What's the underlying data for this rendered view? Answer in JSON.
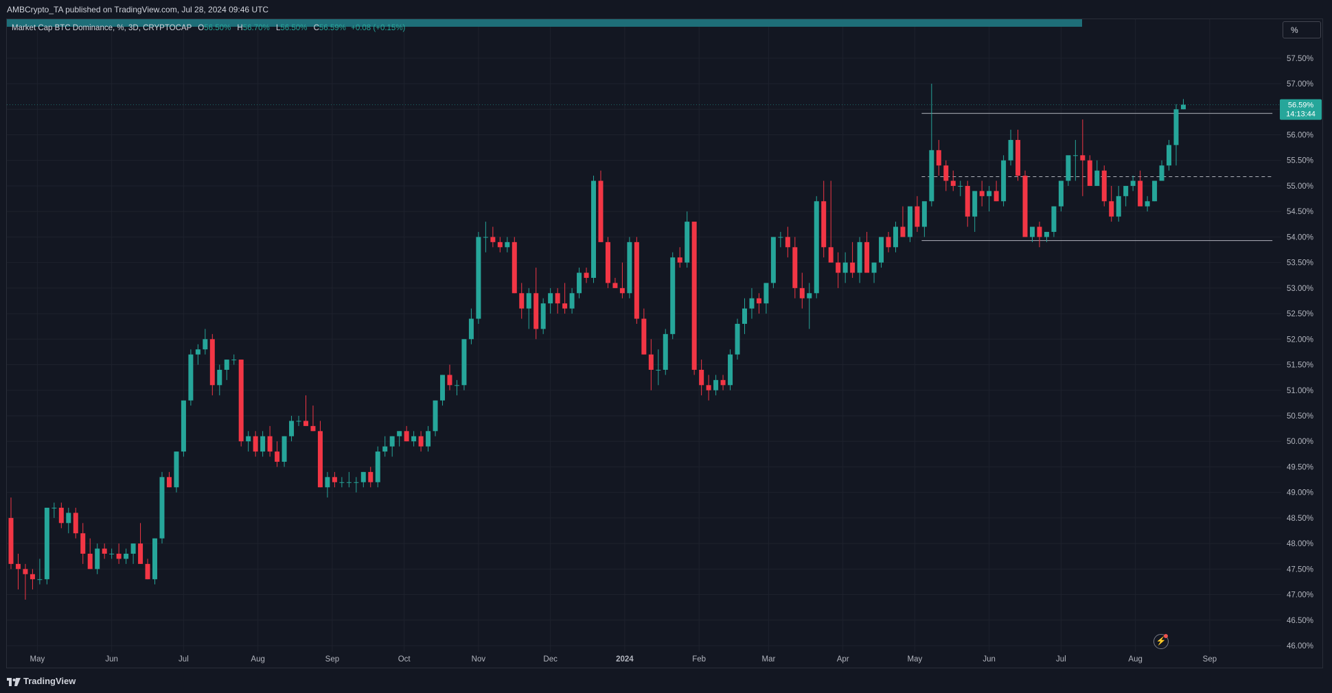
{
  "header": {
    "published": "AMBCrypto_TA published on TradingView.com, Jul 28, 2024 09:46 UTC"
  },
  "legend": {
    "title": "Market Cap BTC Dominance, %, 3D, CRYPTOCAP",
    "o_key": "O",
    "o_val": "56.50%",
    "h_key": "H",
    "h_val": "56.70%",
    "l_key": "L",
    "l_val": "56.50%",
    "c_key": "C",
    "c_val": "56.59%",
    "change": "+0.08 (+0.15%)"
  },
  "toolbar": {
    "unit_button": "%"
  },
  "price_label": {
    "value": "56.59%",
    "countdown": "14:13:44"
  },
  "footer": {
    "brand": "TradingView"
  },
  "colors": {
    "up": "#26a69a",
    "down": "#f23645",
    "background": "#131722",
    "grid": "#1e222d",
    "text": "#b2b5be"
  },
  "chart_data": {
    "type": "candlestick",
    "timeframe": "3D",
    "y_axis": {
      "ylim": [
        46.0,
        57.75
      ],
      "tick_labels": [
        "46.00%",
        "46.50%",
        "47.00%",
        "47.50%",
        "48.00%",
        "48.50%",
        "49.00%",
        "49.50%",
        "50.00%",
        "50.50%",
        "51.00%",
        "51.50%",
        "52.00%",
        "52.50%",
        "53.00%",
        "53.50%",
        "54.00%",
        "54.50%",
        "55.00%",
        "55.50%",
        "56.00%",
        "56.50%",
        "57.00%",
        "57.50%"
      ]
    },
    "x_axis": {
      "labels": [
        "May",
        "Jun",
        "Jul",
        "Aug",
        "Sep",
        "Oct",
        "Nov",
        "Dec",
        "2024",
        "Feb",
        "Mar",
        "Apr",
        "May",
        "Jun",
        "Jul",
        "Aug",
        "Sep"
      ],
      "start_date": "2023-04-20",
      "label_dates": [
        "2023-05-01",
        "2023-06-01",
        "2023-07-01",
        "2023-08-01",
        "2023-09-01",
        "2023-10-01",
        "2023-11-01",
        "2023-12-01",
        "2024-01-01",
        "2024-02-01",
        "2024-03-01",
        "2024-04-01",
        "2024-05-01",
        "2024-06-01",
        "2024-07-01",
        "2024-08-01",
        "2024-09-01"
      ]
    },
    "candles": [
      [
        48.5,
        48.9,
        47.5,
        47.6
      ],
      [
        47.6,
        47.8,
        47.1,
        47.5
      ],
      [
        47.5,
        47.6,
        46.9,
        47.4
      ],
      [
        47.4,
        47.5,
        47.1,
        47.3
      ],
      [
        47.3,
        47.7,
        47.2,
        47.3
      ],
      [
        47.3,
        48.7,
        47.2,
        48.7
      ],
      [
        48.7,
        48.8,
        48.5,
        48.7
      ],
      [
        48.7,
        48.8,
        48.3,
        48.4
      ],
      [
        48.4,
        48.7,
        48.2,
        48.6
      ],
      [
        48.6,
        48.7,
        48.1,
        48.2
      ],
      [
        48.2,
        48.4,
        47.6,
        47.8
      ],
      [
        47.8,
        48.1,
        47.5,
        47.5
      ],
      [
        47.5,
        48.0,
        47.4,
        47.9
      ],
      [
        47.9,
        48.0,
        47.7,
        47.8
      ],
      [
        47.8,
        47.9,
        47.7,
        47.8
      ],
      [
        47.8,
        48.0,
        47.6,
        47.7
      ],
      [
        47.7,
        47.9,
        47.6,
        47.8
      ],
      [
        47.8,
        48.0,
        47.6,
        48.0
      ],
      [
        48.0,
        48.4,
        47.6,
        47.6
      ],
      [
        47.6,
        47.7,
        47.3,
        47.3
      ],
      [
        47.3,
        48.1,
        47.2,
        48.1
      ],
      [
        48.1,
        49.4,
        48.0,
        49.3
      ],
      [
        49.3,
        49.4,
        49.1,
        49.1
      ],
      [
        49.1,
        49.8,
        49.0,
        49.8
      ],
      [
        49.8,
        50.8,
        49.7,
        50.8
      ],
      [
        50.8,
        51.8,
        50.7,
        51.7
      ],
      [
        51.7,
        51.9,
        51.5,
        51.8
      ],
      [
        51.8,
        52.2,
        51.7,
        52.0
      ],
      [
        52.0,
        52.1,
        50.9,
        51.1
      ],
      [
        51.1,
        51.5,
        50.9,
        51.4
      ],
      [
        51.4,
        51.6,
        51.2,
        51.6
      ],
      [
        51.6,
        51.7,
        51.5,
        51.6
      ],
      [
        51.6,
        51.6,
        49.9,
        50.0
      ],
      [
        50.0,
        50.2,
        49.8,
        50.1
      ],
      [
        50.1,
        50.2,
        49.7,
        49.8
      ],
      [
        49.8,
        50.2,
        49.7,
        50.1
      ],
      [
        50.1,
        50.3,
        49.7,
        49.8
      ],
      [
        49.8,
        50.0,
        49.5,
        49.6
      ],
      [
        49.6,
        50.1,
        49.5,
        50.1
      ],
      [
        50.1,
        50.5,
        50.0,
        50.4
      ],
      [
        50.4,
        50.5,
        50.3,
        50.4
      ],
      [
        50.4,
        50.9,
        50.3,
        50.3
      ],
      [
        50.3,
        50.7,
        50.2,
        50.2
      ],
      [
        50.2,
        50.4,
        49.1,
        49.1
      ],
      [
        49.1,
        49.4,
        48.9,
        49.3
      ],
      [
        49.3,
        49.4,
        49.1,
        49.2
      ],
      [
        49.2,
        49.3,
        49.1,
        49.2
      ],
      [
        49.2,
        49.4,
        49.1,
        49.2
      ],
      [
        49.2,
        49.3,
        49.0,
        49.2
      ],
      [
        49.2,
        49.4,
        49.1,
        49.4
      ],
      [
        49.4,
        49.5,
        49.1,
        49.2
      ],
      [
        49.2,
        49.9,
        49.1,
        49.8
      ],
      [
        49.8,
        50.1,
        49.7,
        49.9
      ],
      [
        49.9,
        50.1,
        49.7,
        50.1
      ],
      [
        50.1,
        50.2,
        49.9,
        50.2
      ],
      [
        50.2,
        50.3,
        50.0,
        50.0
      ],
      [
        50.0,
        50.2,
        49.9,
        50.1
      ],
      [
        50.1,
        50.2,
        49.8,
        49.9
      ],
      [
        49.9,
        50.3,
        49.8,
        50.2
      ],
      [
        50.2,
        50.8,
        50.1,
        50.8
      ],
      [
        50.8,
        51.3,
        50.7,
        51.3
      ],
      [
        51.3,
        51.5,
        51.0,
        51.1
      ],
      [
        51.1,
        51.2,
        50.9,
        51.1
      ],
      [
        51.1,
        52.0,
        51.0,
        52.0
      ],
      [
        52.0,
        52.6,
        51.9,
        52.4
      ],
      [
        52.4,
        54.1,
        52.3,
        54.0
      ],
      [
        54.0,
        54.3,
        53.7,
        54.0
      ],
      [
        54.0,
        54.2,
        53.8,
        53.9
      ],
      [
        53.9,
        54.0,
        53.7,
        53.8
      ],
      [
        53.8,
        54.0,
        53.7,
        53.9
      ],
      [
        53.9,
        54.0,
        52.9,
        52.9
      ],
      [
        52.9,
        53.1,
        52.4,
        52.6
      ],
      [
        52.6,
        53.0,
        52.2,
        52.9
      ],
      [
        52.9,
        53.4,
        52.0,
        52.2
      ],
      [
        52.2,
        52.8,
        52.1,
        52.7
      ],
      [
        52.7,
        53.0,
        52.5,
        52.9
      ],
      [
        52.9,
        53.0,
        52.5,
        52.7
      ],
      [
        52.7,
        53.1,
        52.5,
        52.6
      ],
      [
        52.6,
        53.0,
        52.5,
        52.9
      ],
      [
        52.9,
        53.4,
        52.8,
        53.3
      ],
      [
        53.3,
        53.4,
        53.1,
        53.2
      ],
      [
        53.2,
        55.2,
        53.1,
        55.1
      ],
      [
        55.1,
        55.3,
        53.9,
        53.9
      ],
      [
        53.9,
        54.0,
        53.0,
        53.1
      ],
      [
        53.1,
        53.2,
        53.0,
        53.0
      ],
      [
        53.0,
        53.5,
        52.8,
        52.9
      ],
      [
        52.9,
        54.0,
        52.8,
        53.9
      ],
      [
        53.9,
        54.0,
        52.3,
        52.4
      ],
      [
        52.4,
        52.6,
        51.7,
        51.7
      ],
      [
        51.7,
        52.0,
        51.0,
        51.4
      ],
      [
        51.4,
        51.8,
        51.1,
        51.4
      ],
      [
        51.4,
        52.2,
        51.3,
        52.1
      ],
      [
        52.1,
        53.7,
        52.0,
        53.6
      ],
      [
        53.6,
        53.8,
        53.4,
        53.5
      ],
      [
        53.5,
        54.5,
        53.4,
        54.3
      ],
      [
        54.3,
        54.3,
        51.3,
        51.4
      ],
      [
        51.4,
        51.6,
        50.9,
        51.1
      ],
      [
        51.1,
        51.3,
        50.8,
        51.0
      ],
      [
        51.0,
        51.3,
        50.9,
        51.2
      ],
      [
        51.2,
        51.3,
        51.0,
        51.1
      ],
      [
        51.1,
        51.8,
        51.0,
        51.7
      ],
      [
        51.7,
        52.4,
        51.6,
        52.3
      ],
      [
        52.3,
        52.8,
        52.1,
        52.6
      ],
      [
        52.6,
        53.0,
        52.4,
        52.8
      ],
      [
        52.8,
        52.9,
        52.5,
        52.7
      ],
      [
        52.7,
        53.1,
        52.5,
        53.1
      ],
      [
        53.1,
        54.0,
        53.0,
        54.0
      ],
      [
        54.0,
        54.1,
        53.8,
        54.0
      ],
      [
        54.0,
        54.2,
        53.6,
        53.8
      ],
      [
        53.8,
        54.0,
        52.8,
        53.0
      ],
      [
        53.0,
        53.3,
        52.6,
        52.8
      ],
      [
        52.8,
        53.1,
        52.2,
        52.9
      ],
      [
        52.9,
        54.8,
        52.8,
        54.7
      ],
      [
        54.7,
        55.1,
        53.6,
        53.8
      ],
      [
        53.8,
        55.1,
        53.5,
        53.5
      ],
      [
        53.5,
        53.7,
        53.0,
        53.3
      ],
      [
        53.3,
        53.7,
        53.1,
        53.5
      ],
      [
        53.5,
        53.9,
        53.2,
        53.3
      ],
      [
        53.3,
        54.0,
        53.1,
        53.9
      ],
      [
        53.9,
        54.1,
        53.3,
        53.3
      ],
      [
        53.3,
        53.5,
        53.1,
        53.5
      ],
      [
        53.5,
        54.0,
        53.4,
        54.0
      ],
      [
        54.0,
        54.1,
        53.7,
        53.8
      ],
      [
        53.8,
        54.3,
        53.7,
        54.2
      ],
      [
        54.2,
        54.6,
        54.0,
        54.0
      ],
      [
        54.0,
        54.2,
        53.9,
        54.6
      ],
      [
        54.6,
        54.8,
        54.1,
        54.2
      ],
      [
        54.2,
        54.5,
        54.0,
        54.7
      ],
      [
        54.7,
        57.0,
        54.6,
        55.7
      ],
      [
        55.7,
        55.9,
        55.2,
        55.4
      ],
      [
        55.4,
        55.5,
        54.9,
        55.1
      ],
      [
        55.1,
        55.3,
        54.9,
        55.0
      ],
      [
        55.0,
        55.1,
        54.8,
        55.0
      ],
      [
        55.0,
        55.1,
        54.2,
        54.4
      ],
      [
        54.4,
        54.9,
        54.1,
        54.9
      ],
      [
        54.9,
        55.1,
        54.6,
        54.8
      ],
      [
        54.8,
        55.0,
        54.5,
        54.9
      ],
      [
        54.9,
        55.1,
        54.7,
        54.7
      ],
      [
        54.7,
        55.6,
        54.6,
        55.5
      ],
      [
        55.5,
        56.1,
        55.4,
        55.9
      ],
      [
        55.9,
        56.1,
        55.1,
        55.2
      ],
      [
        55.2,
        55.3,
        54.0,
        54.0
      ],
      [
        54.0,
        54.2,
        53.9,
        54.2
      ],
      [
        54.2,
        54.3,
        53.8,
        54.0
      ],
      [
        54.0,
        54.1,
        53.9,
        54.1
      ],
      [
        54.1,
        54.6,
        54.0,
        54.6
      ],
      [
        54.6,
        55.1,
        54.5,
        55.1
      ],
      [
        55.1,
        55.5,
        55.0,
        55.6
      ],
      [
        55.6,
        55.9,
        55.1,
        55.6
      ],
      [
        55.6,
        56.3,
        54.8,
        55.5
      ],
      [
        55.5,
        55.6,
        55.0,
        55.0
      ],
      [
        55.0,
        55.5,
        55.0,
        55.3
      ],
      [
        55.3,
        55.4,
        54.6,
        54.7
      ],
      [
        54.7,
        55.0,
        54.3,
        54.4
      ],
      [
        54.4,
        55.0,
        54.3,
        54.8
      ],
      [
        54.8,
        55.0,
        54.6,
        55.0
      ],
      [
        55.0,
        55.2,
        54.9,
        55.1
      ],
      [
        55.1,
        55.3,
        54.8,
        54.6
      ],
      [
        54.6,
        54.8,
        54.5,
        54.7
      ],
      [
        54.7,
        55.1,
        54.7,
        55.1
      ],
      [
        55.1,
        55.5,
        55.1,
        55.4
      ],
      [
        55.4,
        55.9,
        55.3,
        55.8
      ],
      [
        55.8,
        56.6,
        55.4,
        56.5
      ],
      [
        56.5,
        56.7,
        56.5,
        56.59
      ]
    ],
    "horizontal_lines": [
      {
        "value": 56.42,
        "from_candle": 127,
        "to_candle": 175,
        "style": "solid"
      },
      {
        "value": 55.18,
        "from_candle": 127,
        "to_candle": 175,
        "style": "dashed"
      },
      {
        "value": 53.93,
        "from_candle": 127,
        "to_candle": 175,
        "style": "solid"
      }
    ]
  }
}
